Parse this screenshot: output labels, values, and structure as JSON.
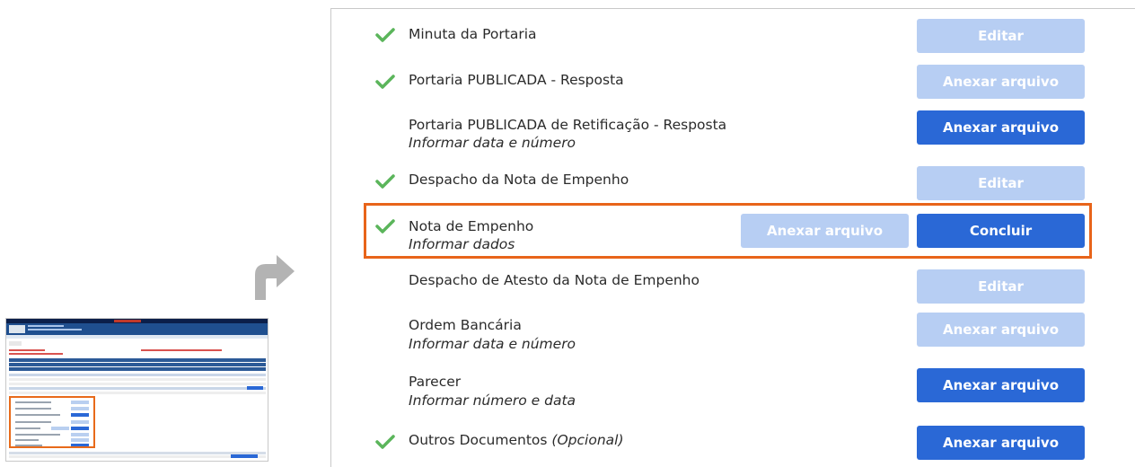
{
  "rows": [
    {
      "title": "Minuta da Portaria",
      "subtitle": "",
      "checked": true,
      "buttons": [
        {
          "label": "Editar",
          "state": "disabled"
        }
      ]
    },
    {
      "title": "Portaria PUBLICADA - Resposta",
      "subtitle": "",
      "checked": true,
      "buttons": [
        {
          "label": "Anexar arquivo",
          "state": "disabled"
        }
      ]
    },
    {
      "title": "Portaria PUBLICADA de Retificação - Resposta",
      "subtitle": "Informar data e número",
      "checked": false,
      "buttons": [
        {
          "label": "Anexar arquivo",
          "state": "enabled"
        }
      ]
    },
    {
      "title": "Despacho da Nota de Empenho",
      "subtitle": "",
      "checked": true,
      "buttons": [
        {
          "label": "Editar",
          "state": "disabled"
        }
      ]
    },
    {
      "title": "Nota de Empenho",
      "subtitle": "Informar dados",
      "checked": true,
      "highlighted": true,
      "buttons": [
        {
          "label": "Anexar arquivo",
          "state": "disabled"
        },
        {
          "label": "Concluir",
          "state": "enabled"
        }
      ]
    },
    {
      "title": "Despacho de Atesto da Nota de Empenho",
      "subtitle": "",
      "checked": false,
      "buttons": [
        {
          "label": "Editar",
          "state": "disabled"
        }
      ]
    },
    {
      "title": "Ordem Bancária",
      "subtitle": "Informar data e número",
      "checked": false,
      "buttons": [
        {
          "label": "Anexar arquivo",
          "state": "disabled"
        }
      ]
    },
    {
      "title": "Parecer",
      "subtitle": "Informar número e data",
      "checked": false,
      "buttons": [
        {
          "label": "Anexar arquivo",
          "state": "enabled"
        }
      ]
    },
    {
      "title": "Outros Documentos",
      "title_suffix": "(Opcional)",
      "subtitle": "",
      "checked": true,
      "buttons": [
        {
          "label": "Anexar arquivo",
          "state": "enabled"
        }
      ]
    }
  ],
  "colors": {
    "button_enabled": "#2a68d6",
    "button_disabled": "#b7cef3",
    "check": "#5bb55b",
    "highlight_border": "#e8641a"
  },
  "icons": {
    "check": "check-icon",
    "arrow": "turn-right-arrow-icon"
  }
}
